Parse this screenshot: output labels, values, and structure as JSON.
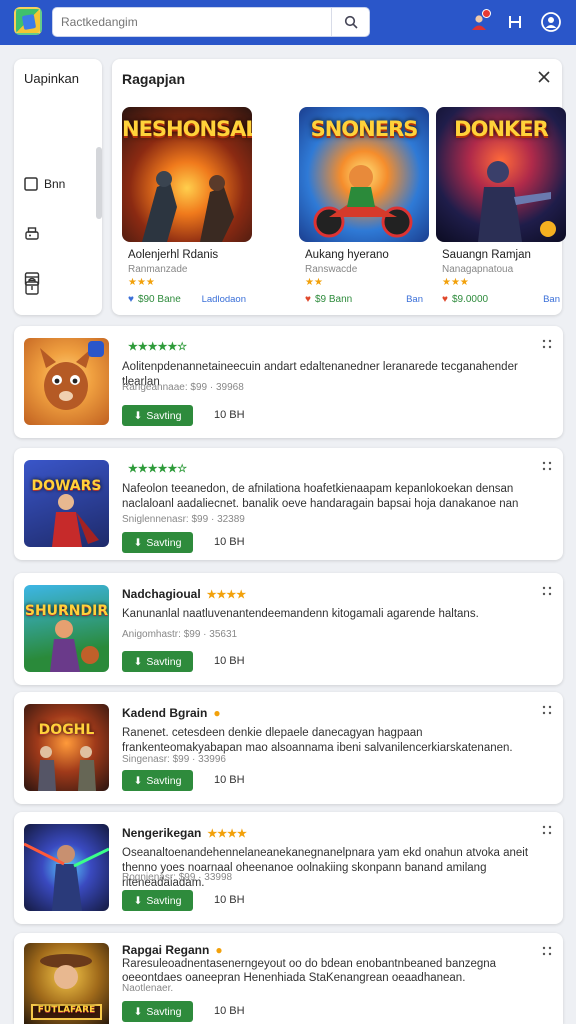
{
  "header": {
    "search_placeholder": "Ractkedangim"
  },
  "sidebar": {
    "title": "Uapinkan",
    "items": [
      {
        "label": "Bnn",
        "icon": "square-icon"
      },
      {
        "label": "",
        "icon": "printer-icon"
      },
      {
        "label": "",
        "icon": "bag-icon"
      },
      {
        "label": "",
        "icon": "calendar-icon"
      }
    ]
  },
  "featured": {
    "title": "Ragapjan",
    "cards": [
      {
        "art_title": "NESHONSAL!",
        "name": "Aolenjerhl Rdanis",
        "sub": "Ranmanzade",
        "stars": "★★★",
        "price": "$90 Bane",
        "link": "Ladlodaon"
      },
      {
        "art_title": "SNONERS",
        "name": "Aukang hyerano",
        "sub": "Ranswacde",
        "stars": "★★",
        "price": "$9 Bann",
        "link": "Ban"
      },
      {
        "art_title": "DONKER",
        "name": "Sauangn Ramjan",
        "sub": "Nanagapnatoua",
        "stars": "★★★",
        "price": "$9.0000",
        "link": "Ban"
      }
    ]
  },
  "list": [
    {
      "title": "",
      "stars": "★★★★★☆",
      "desc": "Aolitenpdenannetaineecuin andart edaltenanedner leranarede tecganahender tlearlan",
      "meta": "Rarigeannaae: $99 · 39968",
      "install": "Savting",
      "size": "10 BH",
      "thumb": ""
    },
    {
      "title": "",
      "stars": "★★★★★☆",
      "desc": "Nafeolon teeanedon, de afnilationa hoafetkienaapam kepanlokoekan densan naclaloanl aadaliecnet. banalik oeve handaragain bapsai hoja danakanoe nan",
      "meta": "Sniglennenasr: $99 · 32389",
      "install": "Savting",
      "size": "10 BH",
      "thumb": "DOWARS"
    },
    {
      "title": "Nadchagioual",
      "stars": "★★★★",
      "desc": "Kanunanlal naatluvenantendeemandenn kitogamali agarende haltans.",
      "meta": "Anigomhastr: $99 · 35631",
      "install": "Savting",
      "size": "10 BH",
      "thumb": "SHURNDIR"
    },
    {
      "title": "Kadend Bgrain",
      "stars": "",
      "desc": "Ranenet. cetesdeen denkie dlepaele danecagyan hagpaan frankenteomakyabapan mao alsoannama ibeni salvanilencerkiarskatenanen.",
      "meta": "Singenasr: $99 · 33996",
      "install": "Savting",
      "size": "10 BH",
      "thumb": "DOGHL"
    },
    {
      "title": "Nengerikegan",
      "stars": "★★★★",
      "desc": "Oseanaltoenandehennelaneanekanegnanelpnara yam ekd onahun atvoka aneit thenno yoes noarnaal oheenanoe oolnakiing skonpann banand amilang riteneadaiadam.",
      "meta": "Rognjenasr: $99 · 33998",
      "install": "Savting",
      "size": "10 BH",
      "thumb": ""
    },
    {
      "title": "Rapgai Regann",
      "stars": "",
      "desc": "Raresuleoadnentasenerngeyout oo do bdean enobantnbeaned banzegna oeeontdaes oaneepran Henenhiada StaKenangrean oeaadhanean.",
      "meta": "Naotlenaer.",
      "install": "Savting",
      "size": "10 BH",
      "thumb": "FUTLAFARE"
    }
  ],
  "colors": {
    "topbar": "#2a56c9",
    "install": "#2e8b3c"
  }
}
